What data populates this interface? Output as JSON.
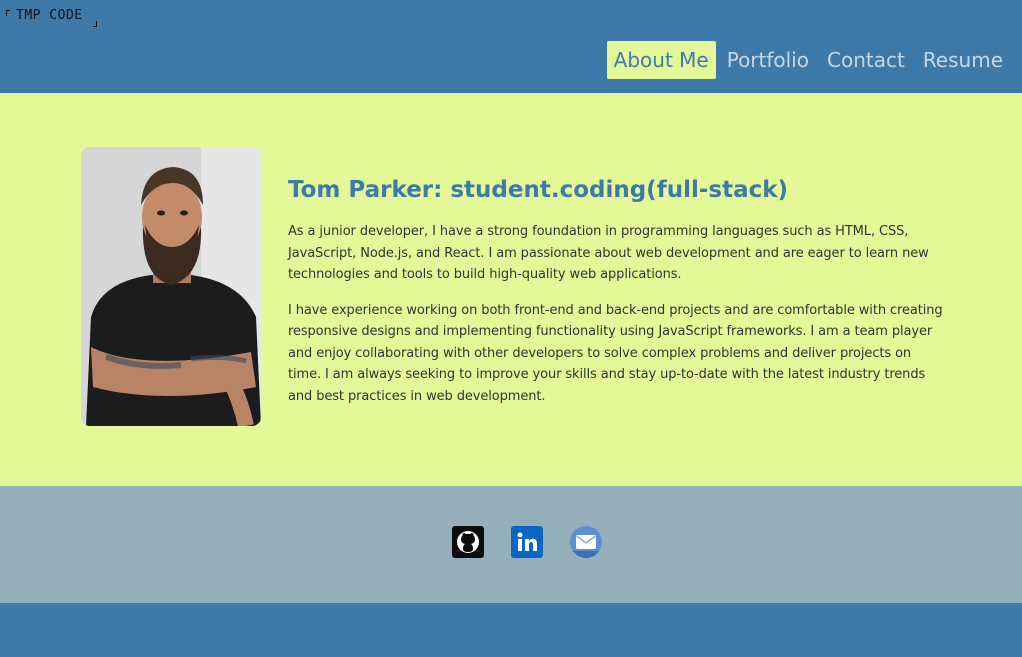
{
  "header": {
    "logo_text": "TMP CODE",
    "nav": [
      {
        "label": "About Me",
        "active": true
      },
      {
        "label": "Portfolio",
        "active": false
      },
      {
        "label": "Contact",
        "active": false
      },
      {
        "label": "Resume",
        "active": false
      }
    ]
  },
  "about": {
    "title": "Tom Parker: student.coding(full-stack)",
    "paragraphs": [
      "As a junior developer, I have a strong foundation in programming languages such as HTML, CSS, JavaScript, Node.js, and React. I am passionate about web development and are eager to learn new technologies and tools to build high-quality web applications.",
      "I have experience working on both front-end and back-end projects and are comfortable with creating responsive designs and implementing functionality using JavaScript frameworks. I am a team player and enjoy collaborating with other developers to solve complex problems and deliver projects on time. I am always seeking to improve your skills and stay up-to-date with the latest industry trends and best practices in web development."
    ]
  },
  "footer": {
    "socials": [
      "github-icon",
      "linkedin-icon",
      "email-icon"
    ]
  },
  "colors": {
    "header_bg": "#3d7aaa",
    "main_bg": "#e4f898",
    "footer_bg": "#95afba",
    "accent": "#3d7aaa"
  }
}
